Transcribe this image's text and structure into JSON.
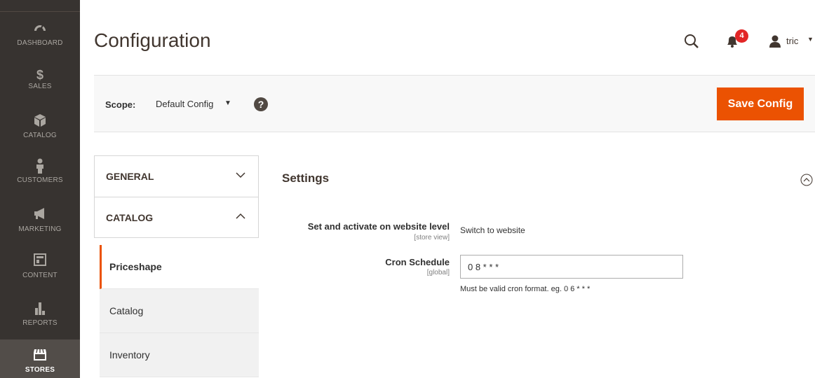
{
  "nav": {
    "items": [
      {
        "label": "DASHBOARD",
        "icon": "dashboard-icon"
      },
      {
        "label": "SALES",
        "icon": "dollar-icon",
        "glyph": "$"
      },
      {
        "label": "CATALOG",
        "icon": "cube-icon"
      },
      {
        "label": "CUSTOMERS",
        "icon": "person-icon"
      },
      {
        "label": "MARKETING",
        "icon": "megaphone-icon"
      },
      {
        "label": "CONTENT",
        "icon": "layout-icon"
      },
      {
        "label": "REPORTS",
        "icon": "bar-chart-icon"
      },
      {
        "label": "STORES",
        "icon": "store-icon"
      }
    ],
    "active": "STORES"
  },
  "header": {
    "title": "Configuration",
    "notification_count": "4",
    "user_name": "tric"
  },
  "scope": {
    "label": "Scope:",
    "value": "Default Config",
    "help": "?",
    "save_label": "Save Config"
  },
  "tabs": {
    "groups": [
      {
        "label": "GENERAL"
      },
      {
        "label": "CATALOG"
      }
    ],
    "items": [
      {
        "label": "Priceshape"
      },
      {
        "label": "Catalog"
      },
      {
        "label": "Inventory"
      }
    ]
  },
  "main": {
    "section_title": "Settings",
    "rows": [
      {
        "label": "Set and activate on website level",
        "scope": "[store view]",
        "value": "Switch to website"
      },
      {
        "label": "Cron Schedule",
        "scope": "[global]",
        "value": "0 8 * * *",
        "note": "Must be valid cron format. eg. 0 6 * * *"
      }
    ]
  },
  "colors": {
    "nav_bg": "#373330",
    "accent": "#eb5202",
    "badge": "#e22626"
  }
}
